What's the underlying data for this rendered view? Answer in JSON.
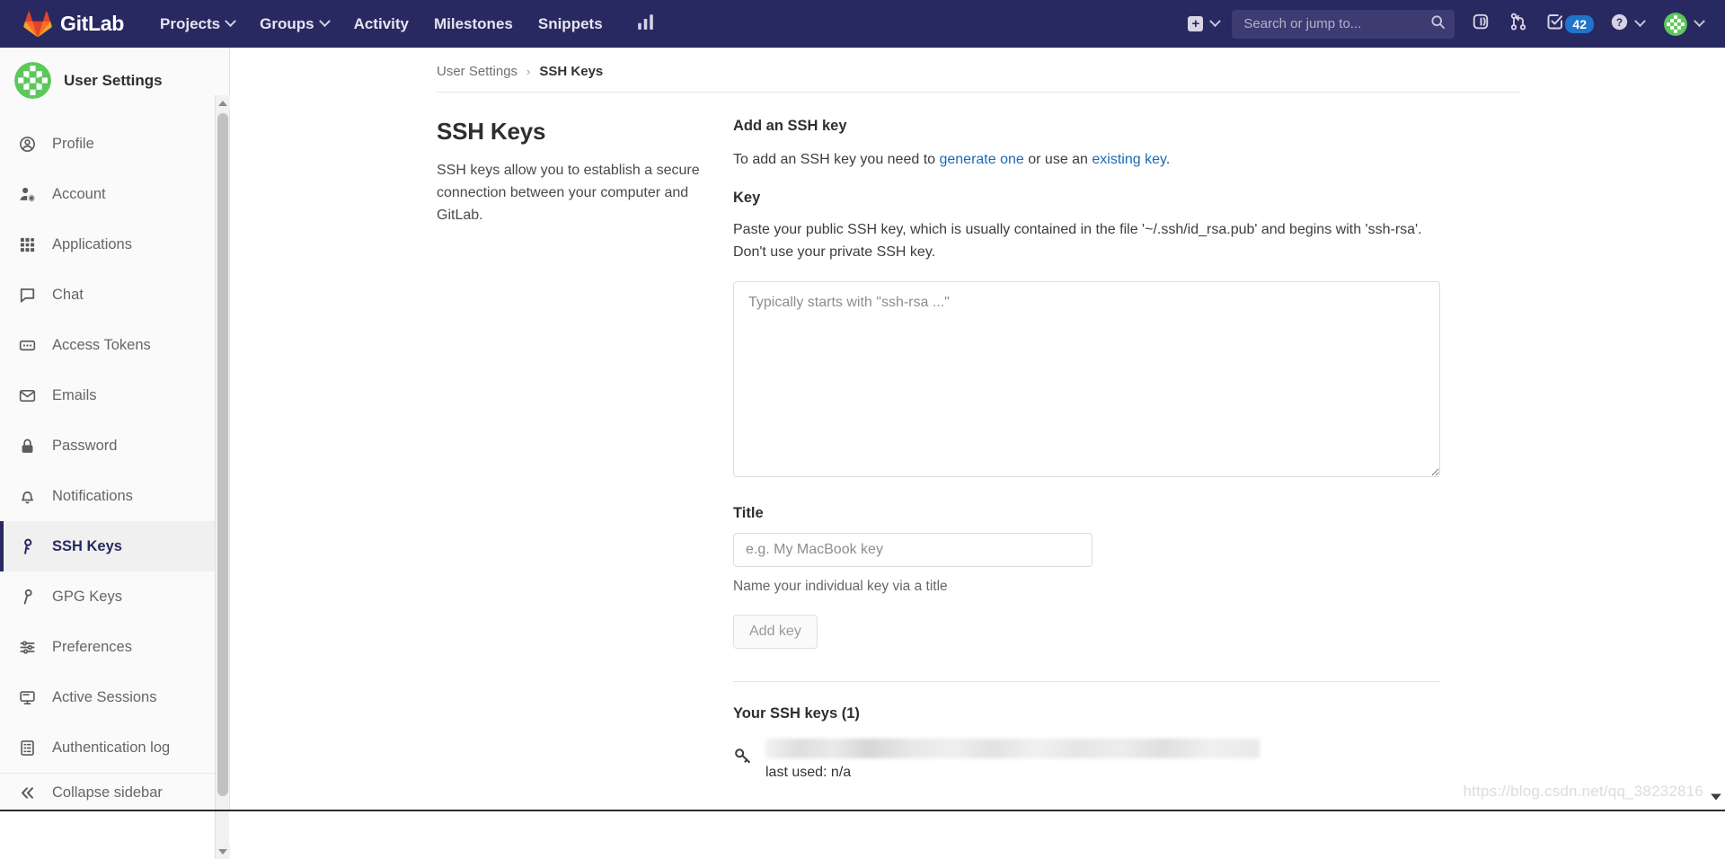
{
  "topnav": {
    "brand": "GitLab",
    "logo_icon": "gitlab-tanuki-icon",
    "links": [
      {
        "label": "Projects",
        "has_caret": true
      },
      {
        "label": "Groups",
        "has_caret": true
      },
      {
        "label": "Activity",
        "has_caret": false
      },
      {
        "label": "Milestones",
        "has_caret": false
      },
      {
        "label": "Snippets",
        "has_caret": false
      }
    ],
    "analytics_icon": "chart-bar-icon",
    "create_new": {
      "icon": "plus-square-icon",
      "caret": true
    },
    "search": {
      "placeholder": "Search or jump to...",
      "value": "",
      "icon": "search-icon"
    },
    "issues_icon": "issues-icon",
    "merge_requests_icon": "merge-request-icon",
    "todos": {
      "icon": "todo-checkmark-icon",
      "count": "42"
    },
    "help": {
      "icon": "help-circle-icon",
      "caret": true
    },
    "user": {
      "avatar_icon": "user-avatar-identicon",
      "caret": true
    }
  },
  "sidebar": {
    "avatar_icon": "user-avatar-identicon",
    "title": "User Settings",
    "items": [
      {
        "label": "Profile",
        "icon": "profile-circle-icon",
        "active": false
      },
      {
        "label": "Account",
        "icon": "account-gear-icon",
        "active": false
      },
      {
        "label": "Applications",
        "icon": "applications-grid-icon",
        "active": false
      },
      {
        "label": "Chat",
        "icon": "chat-bubble-icon",
        "active": false
      },
      {
        "label": "Access Tokens",
        "icon": "access-token-icon",
        "active": false
      },
      {
        "label": "Emails",
        "icon": "envelope-icon",
        "active": false
      },
      {
        "label": "Password",
        "icon": "lock-icon",
        "active": false
      },
      {
        "label": "Notifications",
        "icon": "bell-icon",
        "active": false
      },
      {
        "label": "SSH Keys",
        "icon": "key-icon",
        "active": true
      },
      {
        "label": "GPG Keys",
        "icon": "gpg-key-icon",
        "active": false
      },
      {
        "label": "Preferences",
        "icon": "sliders-icon",
        "active": false
      },
      {
        "label": "Active Sessions",
        "icon": "monitor-icon",
        "active": false
      },
      {
        "label": "Authentication log",
        "icon": "log-list-icon",
        "active": false
      }
    ],
    "collapse": {
      "label": "Collapse sidebar",
      "icon": "double-chevron-left-icon"
    }
  },
  "breadcrumb": {
    "parent": "User Settings",
    "separator": "›",
    "current": "SSH Keys"
  },
  "page": {
    "heading": "SSH Keys",
    "description": "SSH keys allow you to establish a secure connection between your computer and GitLab."
  },
  "form": {
    "section_heading": "Add an SSH key",
    "intro_prefix": "To add an SSH key you need to ",
    "intro_link1": "generate one",
    "intro_middle": " or use an ",
    "intro_link2": "existing key",
    "intro_suffix": ".",
    "key_label": "Key",
    "key_help": "Paste your public SSH key, which is usually contained in the file '~/.ssh/id_rsa.pub' and begins with 'ssh-rsa'. Don't use your private SSH key.",
    "key_placeholder": "Typically starts with \"ssh-rsa ...\"",
    "key_value": "",
    "title_label": "Title",
    "title_placeholder": "e.g. My MacBook key",
    "title_value": "",
    "title_helper": "Name your individual key via a title",
    "submit_label": "Add key"
  },
  "keys_list": {
    "heading": "Your SSH keys (1)",
    "rows": [
      {
        "icon": "key-icon",
        "name_redacted": true,
        "meta": "last used: n/a"
      }
    ]
  },
  "watermark": "https://blog.csdn.net/qq_38232816",
  "colors": {
    "nav_bg": "#292961",
    "accent": "#292961",
    "link": "#1b69b6",
    "badge": "#1f75cb",
    "avatar_green": "#4caf50"
  }
}
